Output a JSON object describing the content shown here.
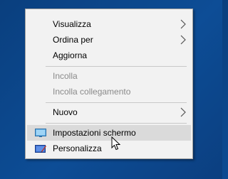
{
  "context_menu": {
    "items": [
      {
        "label": "Visualizza",
        "submenu": true,
        "enabled": true
      },
      {
        "label": "Ordina per",
        "submenu": true,
        "enabled": true
      },
      {
        "label": "Aggiorna",
        "submenu": false,
        "enabled": true
      },
      {
        "label": "Incolla",
        "submenu": false,
        "enabled": false
      },
      {
        "label": "Incolla collegamento",
        "submenu": false,
        "enabled": false
      },
      {
        "label": "Nuovo",
        "submenu": true,
        "enabled": true
      },
      {
        "label": "Impostazioni schermo",
        "submenu": false,
        "enabled": true,
        "icon": "display-settings-icon",
        "highlighted": true
      },
      {
        "label": "Personalizza",
        "submenu": false,
        "enabled": true,
        "icon": "personalize-icon"
      }
    ]
  },
  "colors": {
    "desktop_background": "#0d4d96",
    "menu_background": "#f2f2f2",
    "highlight": "#dadada",
    "disabled_text": "#8a8a8a"
  }
}
